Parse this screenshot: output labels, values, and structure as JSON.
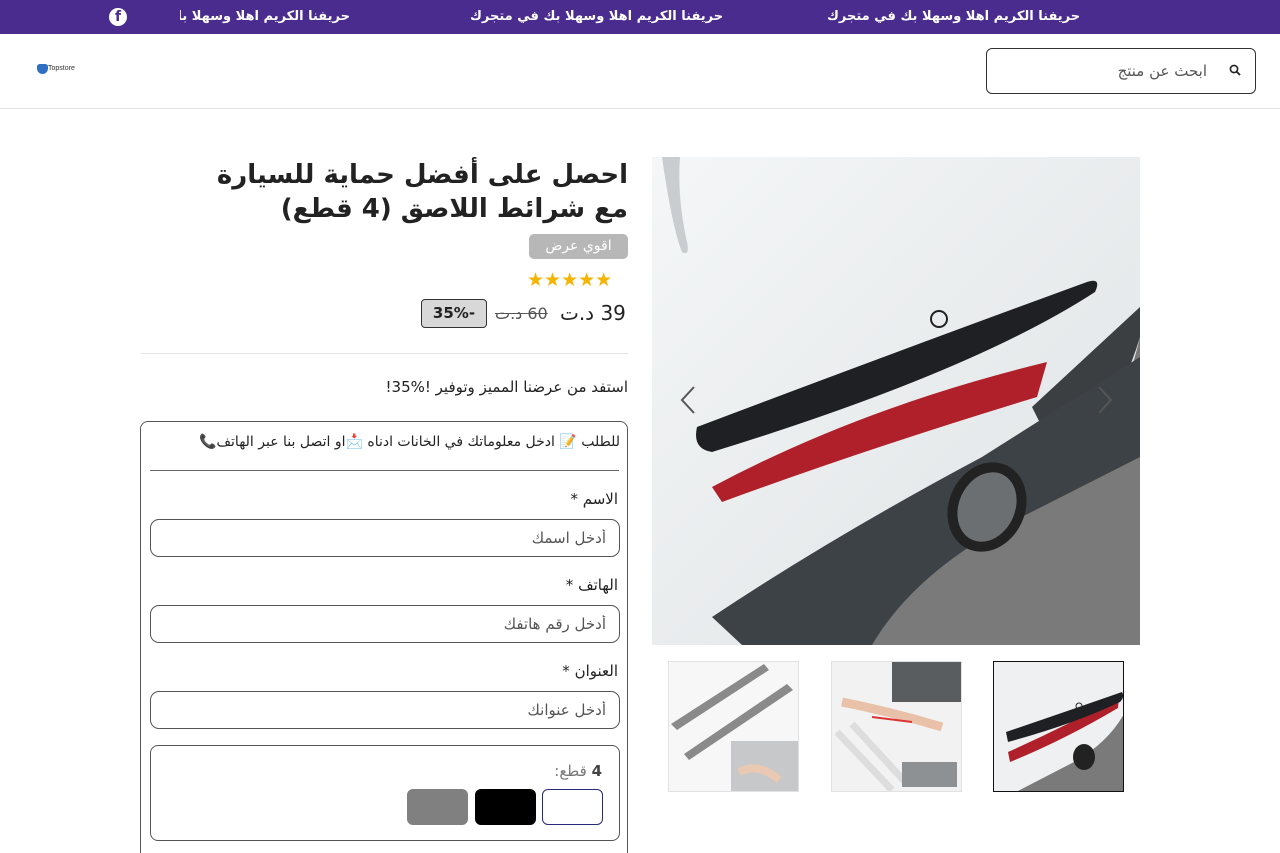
{
  "announcement": {
    "messages": [
      "حريفنا الكريم اهلا وسهلا بك في متجرك",
      "حريفنا الكريم اهلا وسهلا بك في متجرك",
      "حريفنا الكريم اهلا وسهلا بك"
    ],
    "social_icon": "facebook-icon"
  },
  "header": {
    "logo_text": "Topstore",
    "search_placeholder": "ابحث عن منتج",
    "search_icon": "search-icon"
  },
  "product": {
    "title": "احصل على أفضل حماية للسيارة مع شرائط اللاصق (4 قطع)",
    "badge": "اقوي عرض",
    "rating_stars": "★★★★★",
    "rating_value": 5,
    "price": "39 د.ت",
    "old_price": "60 د.ت",
    "discount": "35%-",
    "promo": "استفد من عرضنا المميز وتوفير !%35!"
  },
  "gallery": {
    "prev_icon": "chevron-left-icon",
    "next_icon": "chevron-right-icon",
    "thumbnails": 3,
    "active_thumbnail": 3
  },
  "form": {
    "header": "للطلب 📝 ادخل معلوماتك في الخانات ادناه 📩او اتصل بنا عبر الهاتف📞",
    "name_label": "الاسم *",
    "name_placeholder": "أدخل اسمك",
    "phone_label": "الهاتف *",
    "phone_placeholder": "أدخل رقم هاتفك",
    "address_label": "العنوان *",
    "address_placeholder": "أدخل عنوانك",
    "variant_label": "قطع:",
    "variant_value": "4",
    "swatches": [
      {
        "name": "white",
        "color": "#ffffff",
        "selected": true
      },
      {
        "name": "black",
        "color": "#000000",
        "selected": false
      },
      {
        "name": "grey",
        "color": "#808080",
        "selected": false
      }
    ]
  },
  "colors": {
    "topbar": "#4a2c8f",
    "badge": "#b7b7b7",
    "stars": "#f5b400",
    "swatch_selected_border": "#2a2a7a"
  }
}
